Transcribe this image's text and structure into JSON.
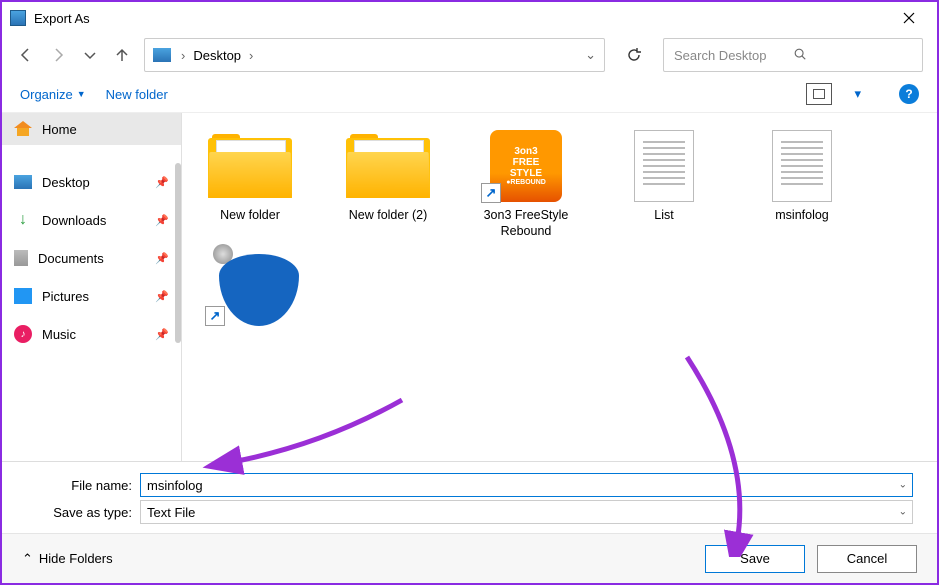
{
  "window": {
    "title": "Export As"
  },
  "nav": {
    "path_segments": [
      "Desktop"
    ],
    "search_placeholder": "Search Desktop"
  },
  "toolbar": {
    "organize": "Organize",
    "new_folder": "New folder"
  },
  "sidebar": {
    "home": "Home",
    "items": [
      {
        "label": "Desktop",
        "icon": "desktop"
      },
      {
        "label": "Downloads",
        "icon": "downloads"
      },
      {
        "label": "Documents",
        "icon": "documents"
      },
      {
        "label": "Pictures",
        "icon": "pictures"
      },
      {
        "label": "Music",
        "icon": "music"
      }
    ]
  },
  "files": [
    {
      "label": "New folder",
      "type": "folder"
    },
    {
      "label": "New folder (2)",
      "type": "folder"
    },
    {
      "label": "3on3 FreeStyle Rebound",
      "type": "shortcut-game1"
    },
    {
      "label": "List",
      "type": "textfile"
    },
    {
      "label": "msinfolog",
      "type": "textfile"
    },
    {
      "label": "",
      "type": "shortcut-game2"
    }
  ],
  "filefields": {
    "name_label": "File name:",
    "name_value": "msinfolog",
    "type_label": "Save as type:",
    "type_value": "Text File"
  },
  "footer": {
    "hide_folders": "Hide Folders",
    "save": "Save",
    "cancel": "Cancel"
  },
  "annotation_color": "#9b2fd6"
}
